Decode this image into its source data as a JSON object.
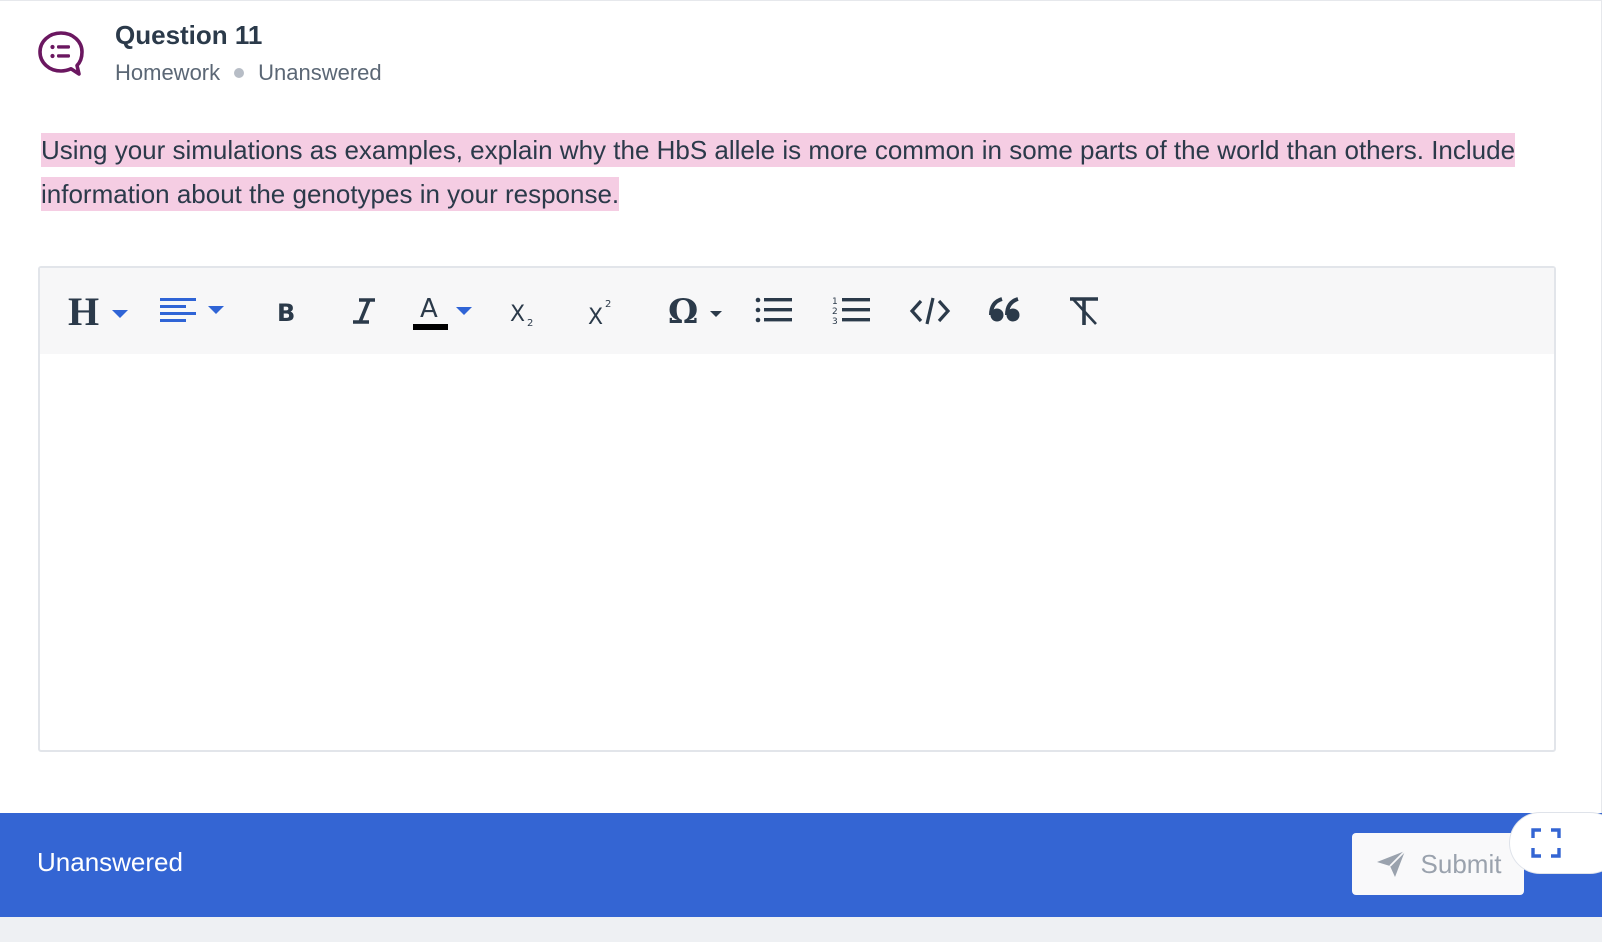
{
  "question": {
    "title": "Question 11",
    "category": "Homework",
    "status": "Unanswered",
    "icon": "question-chat-icon",
    "prompt": "Using your simulations as examples, explain why the HbS allele is more common in some parts of the world than others. Include information about the genotypes in your response."
  },
  "toolbar": {
    "items": [
      "heading-icon",
      "align-left-icon",
      "bold-icon",
      "italic-icon",
      "font-color-icon",
      "subscript-icon",
      "superscript-icon",
      "special-characters-icon",
      "bulleted-list-icon",
      "numbered-list-icon",
      "code-icon",
      "blockquote-icon",
      "remove-format-icon"
    ]
  },
  "footer": {
    "status": "Unanswered",
    "submit_label": "Submit"
  },
  "colors": {
    "footer_bg": "#3465d3",
    "highlight": "#f5cde3",
    "icon_purple": "#6b1760",
    "toolbar_blue": "#2f64d6"
  }
}
